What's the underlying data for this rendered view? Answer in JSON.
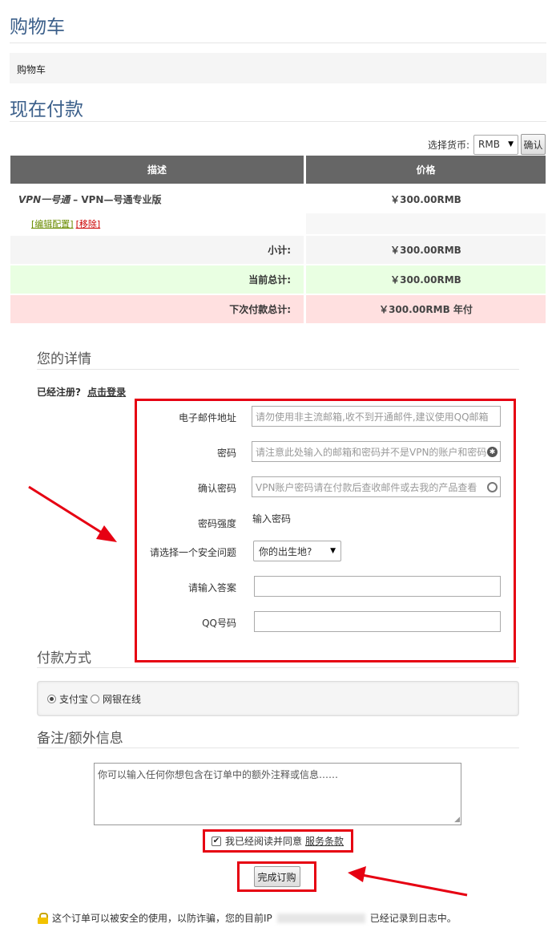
{
  "page_title": "购物车",
  "breadcrumb": "购物车",
  "section_title": "现在付款",
  "currency": {
    "label": "选择货币:",
    "selected": "RMB",
    "confirm_button": "确认"
  },
  "cart": {
    "headers": [
      "描述",
      "价格"
    ],
    "product_group": "VPN一号通",
    "product_name": "– VPN—号通专业版",
    "product_price": "￥300.00RMB",
    "edit_link": "[编辑配置]",
    "remove_link": "[移除]",
    "subtotal_label": "小计:",
    "subtotal_value": "￥300.00RMB",
    "total_label": "当前总计:",
    "total_value": "￥300.00RMB",
    "recurring_label": "下次付款总计:",
    "recurring_value": "￥300.00RMB 年付"
  },
  "details": {
    "heading": "您的详情",
    "already_registered": "已经注册?",
    "login_link": "点击登录",
    "email_label": "电子邮件地址",
    "email_placeholder": "请勿使用非主流邮箱,收不到开通邮件,建议使用QQ邮箱",
    "password_label": "密码",
    "password_placeholder": "请注意此处输入的邮箱和密码并不是VPN的账户和密码",
    "confirm_password_label": "确认密码",
    "confirm_password_placeholder": "VPN账户密码请在付款后查收邮件或去我的产品查看",
    "strength_label": "密码强度",
    "strength_value": "输入密码",
    "security_question_label": "请选择一个安全问题",
    "security_question_selected": "你的出生地?",
    "answer_label": "请输入答案",
    "answer_value": "",
    "qq_label": "QQ号码",
    "qq_value": ""
  },
  "payment": {
    "heading": "付款方式",
    "options": [
      "支付宝",
      "网银在线"
    ],
    "selected": "支付宝"
  },
  "notes": {
    "heading": "备注/额外信息",
    "placeholder": "你可以输入任何你想包含在订单中的额外注释或信息……"
  },
  "tos": {
    "text": "我已经阅读并同意",
    "link": "服务条款",
    "checked": true
  },
  "submit_button": "完成订购",
  "security_notice": {
    "before_ip": "这个订单可以被安全的使用，以防诈骗，您的目前IP",
    "after_ip": "已经记录到日志中。"
  },
  "colors": {
    "title": "#3b5f8a",
    "header_bg": "#666666",
    "total_bg": "#e9ffe2",
    "recurring_bg": "#ffe0e0",
    "highlight": "#e60012"
  }
}
